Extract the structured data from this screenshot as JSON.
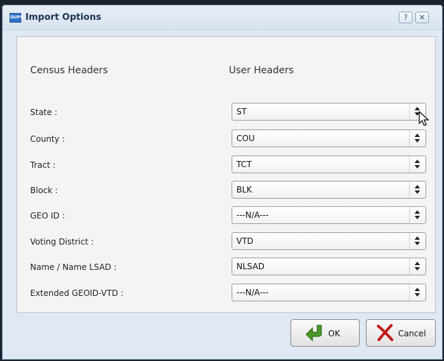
{
  "window": {
    "title": "Import Options",
    "app_icon_text": "DUPS",
    "help_label": "?",
    "close_label": "✕"
  },
  "headers": {
    "census": "Census Headers",
    "user": "User Headers"
  },
  "rows": [
    {
      "label": "State :",
      "value": "ST"
    },
    {
      "label": "County :",
      "value": "COU"
    },
    {
      "label": "Tract :",
      "value": "TCT"
    },
    {
      "label": "Block :",
      "value": "BLK"
    },
    {
      "label": "GEO ID :",
      "value": "---N/A---"
    },
    {
      "label": "Voting District :",
      "value": "VTD"
    },
    {
      "label": "Name / Name LSAD :",
      "value": "NLSAD"
    },
    {
      "label": "Extended GEOID-VTD :",
      "value": "---N/A---"
    }
  ],
  "buttons": {
    "ok": "OK",
    "cancel": "Cancel"
  },
  "icons": {
    "ok": "green-arrow-icon",
    "cancel": "red-x-icon",
    "cursor": "mouse-pointer-icon"
  }
}
